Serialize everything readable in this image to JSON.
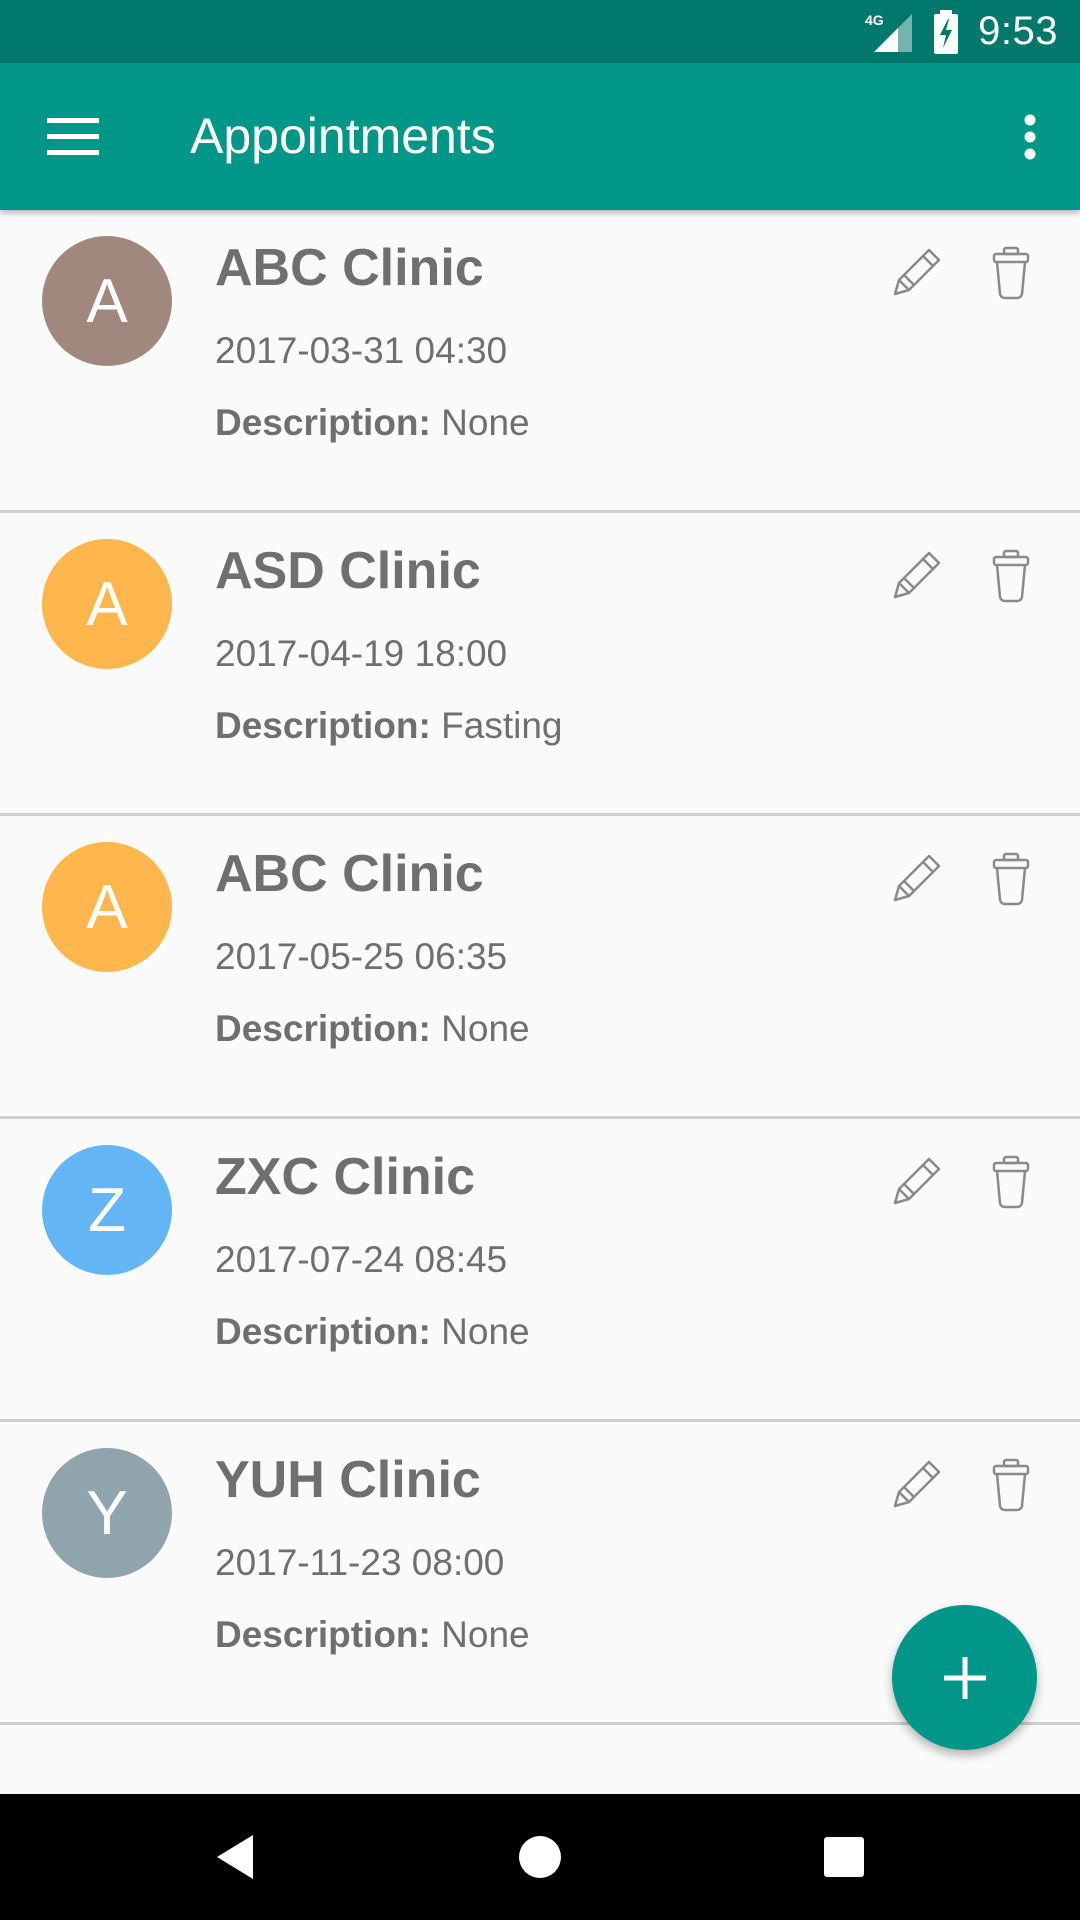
{
  "status_bar": {
    "network_label": "4G",
    "time": "9:53"
  },
  "app_bar": {
    "title": "Appointments"
  },
  "appointments": [
    {
      "initial": "A",
      "avatar_color": "#a1887f",
      "clinic": "ABC Clinic",
      "datetime": "2017-03-31 04:30",
      "description_label": "Description:",
      "description": "None"
    },
    {
      "initial": "A",
      "avatar_color": "#ffb74d",
      "clinic": "ASD Clinic",
      "datetime": "2017-04-19 18:00",
      "description_label": "Description:",
      "description": "Fasting"
    },
    {
      "initial": "A",
      "avatar_color": "#ffb74d",
      "clinic": "ABC Clinic",
      "datetime": "2017-05-25 06:35",
      "description_label": "Description:",
      "description": "None"
    },
    {
      "initial": "Z",
      "avatar_color": "#64b5f6",
      "clinic": "ZXC Clinic",
      "datetime": "2017-07-24 08:45",
      "description_label": "Description:",
      "description": "None"
    },
    {
      "initial": "Y",
      "avatar_color": "#90a4ae",
      "clinic": "YUH Clinic",
      "datetime": "2017-11-23 08:00",
      "description_label": "Description:",
      "description": "None"
    }
  ],
  "icons": {
    "menu": "hamburger-menu-icon",
    "overflow": "more-vert-icon",
    "edit": "pencil-icon",
    "delete": "trash-icon",
    "fab": "plus-icon",
    "nav_back": "back-triangle-icon",
    "nav_home": "home-circle-icon",
    "nav_recents": "recents-square-icon"
  },
  "colors": {
    "primary": "#009688",
    "primary_dark": "#00786c",
    "text": "#6f6f6f"
  }
}
